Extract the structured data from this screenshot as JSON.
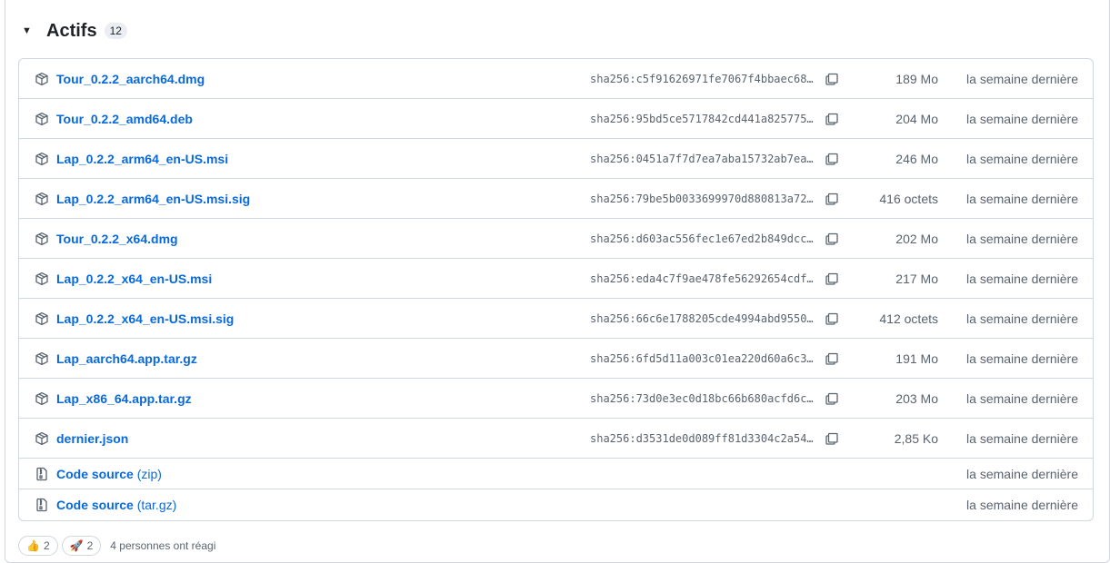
{
  "section": {
    "title": "Actifs",
    "count": "12"
  },
  "assets": [
    {
      "name": "Tour_0.2.2_aarch64.dmg",
      "sha": "sha256:c5f91626971fe7067f4bbaec68…",
      "size": "189 Mo",
      "date": "la semaine dernière"
    },
    {
      "name": "Tour_0.2.2_amd64.deb",
      "sha": "sha256:95bd5ce5717842cd441a825775…",
      "size": "204 Mo",
      "date": "la semaine dernière"
    },
    {
      "name": "Lap_0.2.2_arm64_en-US.msi",
      "sha": "sha256:0451a7f7d7ea7aba15732ab7ea…",
      "size": "246 Mo",
      "date": "la semaine dernière"
    },
    {
      "name": "Lap_0.2.2_arm64_en-US.msi.sig",
      "sha": "sha256:79be5b0033699970d880813a72…",
      "size": "416 octets",
      "date": "la semaine dernière"
    },
    {
      "name": "Tour_0.2.2_x64.dmg",
      "sha": "sha256:d603ac556fec1e67ed2b849dcc…",
      "size": "202 Mo",
      "date": "la semaine dernière"
    },
    {
      "name": "Lap_0.2.2_x64_en-US.msi",
      "sha": "sha256:eda4c7f9ae478fe56292654cdf…",
      "size": "217 Mo",
      "date": "la semaine dernière"
    },
    {
      "name": "Lap_0.2.2_x64_en-US.msi.sig",
      "sha": "sha256:66c6e1788205cde4994abd9550…",
      "size": "412 octets",
      "date": "la semaine dernière"
    },
    {
      "name": "Lap_aarch64.app.tar.gz",
      "sha": "sha256:6fd5d11a003c01ea220d60a6c3…",
      "size": "191 Mo",
      "date": "la semaine dernière"
    },
    {
      "name": "Lap_x86_64.app.tar.gz",
      "sha": "sha256:73d0e3ec0d18bc66b680acfd6c…",
      "size": "203 Mo",
      "date": "la semaine dernière"
    },
    {
      "name": "dernier.json",
      "sha": "sha256:d3531de0d089ff81d3304c2a54…",
      "size": "2,85 Ko",
      "date": "la semaine dernière"
    }
  ],
  "source": [
    {
      "label": "Code source",
      "format": "(zip)",
      "date": "la semaine dernière"
    },
    {
      "label": "Code source",
      "format": "(tar.gz)",
      "date": "la semaine dernière"
    }
  ],
  "reactions": [
    {
      "icon": "thumbs-up-icon",
      "count": "2"
    },
    {
      "icon": "rocket-icon",
      "count": "2"
    }
  ],
  "footer_text": "4 personnes ont réagi",
  "colors": {
    "link": "#0969da",
    "muted": "#59636e",
    "border": "#d0d7de"
  },
  "icons": {
    "caret": "triangle-down-icon",
    "asset": "package-icon",
    "copy": "copy-icon",
    "source": "file-zip-icon"
  }
}
